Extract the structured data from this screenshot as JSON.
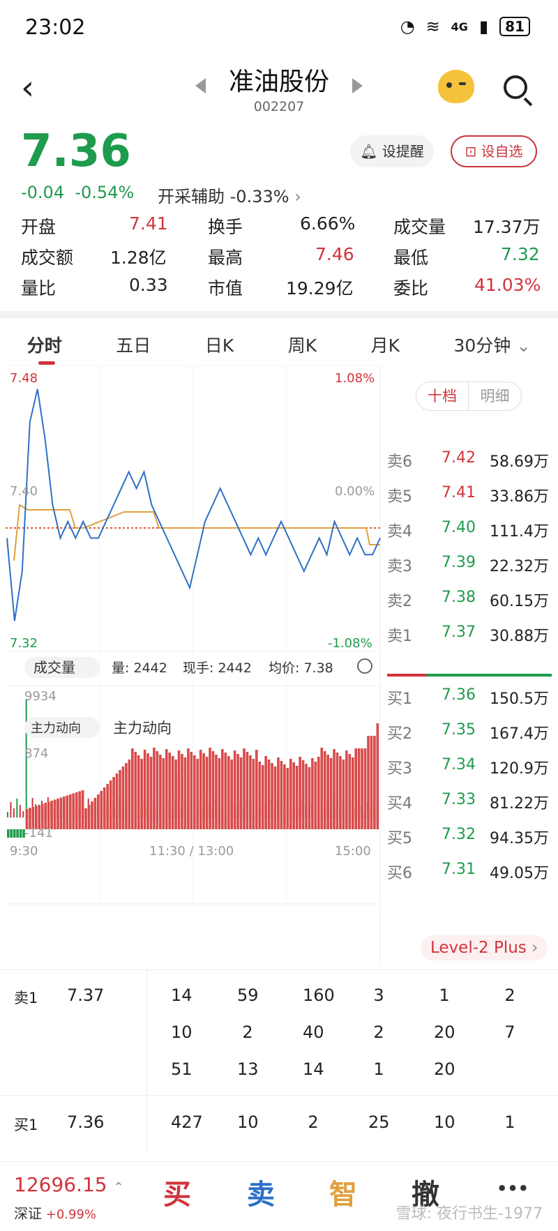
{
  "status_bar": {
    "time": "23:02",
    "network": "4G",
    "battery": "81"
  },
  "header": {
    "title": "准油股份",
    "code": "002207"
  },
  "quote": {
    "price": "7.36",
    "change": "-0.04",
    "change_pct": "-0.54%",
    "aux_label": "开采辅助",
    "aux_value": "-0.33%",
    "alert_label": "设提醒",
    "fav_label": "设自选"
  },
  "stats": [
    {
      "label": "开盘",
      "value": "7.41",
      "color": "red"
    },
    {
      "label": "换手",
      "value": "6.66%",
      "color": "dark"
    },
    {
      "label": "成交量",
      "value": "17.37万",
      "color": "dark"
    },
    {
      "label": "成交额",
      "value": "1.28亿",
      "color": "dark"
    },
    {
      "label": "最高",
      "value": "7.46",
      "color": "red"
    },
    {
      "label": "最低",
      "value": "7.32",
      "color": "green"
    },
    {
      "label": "量比",
      "value": "0.33",
      "color": "dark"
    },
    {
      "label": "市值",
      "value": "19.29亿",
      "color": "dark"
    },
    {
      "label": "委比",
      "value": "41.03%",
      "color": "red"
    }
  ],
  "tabs": [
    "分时",
    "五日",
    "日K",
    "周K",
    "月K",
    "30分钟"
  ],
  "chart": {
    "price_high": "7.48",
    "price_mid": "7.40",
    "price_low": "7.32",
    "pct_high": "1.08%",
    "pct_mid": "0.00%",
    "pct_low": "-1.08%",
    "vol_label": "成交量",
    "vol_amount": "量: 2442",
    "vol_now": "现手: 2442",
    "avg_price": "均价: 7.38",
    "vol_max": "9934",
    "flow_select": "主力动向",
    "flow_title": "主力动向",
    "flow_max": "874",
    "flow_min": "-141",
    "time_start": "9:30",
    "time_mid": "11:30 / 13:00",
    "time_end": "15:00"
  },
  "chart_data": {
    "type": "line",
    "series": [
      {
        "values": [
          7.38,
          7.33,
          7.36,
          7.45,
          7.47,
          7.44,
          7.4,
          7.38,
          7.39,
          7.38,
          7.39,
          7.38,
          7.38,
          7.39,
          7.4,
          7.41,
          7.42,
          7.41,
          7.42,
          7.4,
          7.39,
          7.38,
          7.37,
          7.36,
          7.35,
          7.37,
          7.39,
          7.4,
          7.41,
          7.4,
          7.39,
          7.38,
          7.37,
          7.38,
          7.37,
          7.38,
          7.39,
          7.38,
          7.37,
          7.36,
          7.37,
          7.38,
          7.37,
          7.39,
          7.38,
          7.37,
          7.38,
          7.37,
          7.37,
          7.38
        ]
      }
    ],
    "ylim": [
      7.32,
      7.48
    ]
  },
  "book_toggle": {
    "a": "十档",
    "b": "明细"
  },
  "asks": [
    {
      "label": "卖6",
      "price": "7.42",
      "vol": "58.69万",
      "color": "red"
    },
    {
      "label": "卖5",
      "price": "7.41",
      "vol": "33.86万",
      "color": "red"
    },
    {
      "label": "卖4",
      "price": "7.40",
      "vol": "111.4万",
      "color": "green"
    },
    {
      "label": "卖3",
      "price": "7.39",
      "vol": "22.32万",
      "color": "green"
    },
    {
      "label": "卖2",
      "price": "7.38",
      "vol": "60.15万",
      "color": "green"
    },
    {
      "label": "卖1",
      "price": "7.37",
      "vol": "30.88万",
      "color": "green"
    }
  ],
  "bids": [
    {
      "label": "买1",
      "price": "7.36",
      "vol": "150.5万",
      "color": "green"
    },
    {
      "label": "买2",
      "price": "7.35",
      "vol": "167.4万",
      "color": "green"
    },
    {
      "label": "买3",
      "price": "7.34",
      "vol": "120.9万",
      "color": "green"
    },
    {
      "label": "买4",
      "price": "7.33",
      "vol": "81.22万",
      "color": "green"
    },
    {
      "label": "买5",
      "price": "7.32",
      "vol": "94.35万",
      "color": "green"
    },
    {
      "label": "买6",
      "price": "7.31",
      "vol": "49.05万",
      "color": "green"
    }
  ],
  "level2": "Level-2 Plus",
  "queue": {
    "ask1": {
      "label": "卖1",
      "price": "7.37",
      "rows": [
        [
          "14",
          "59",
          "160",
          "3",
          "1",
          "2"
        ],
        [
          "10",
          "2",
          "40",
          "2",
          "20",
          "7"
        ],
        [
          "51",
          "13",
          "14",
          "1",
          "20",
          ""
        ]
      ]
    },
    "bid1": {
      "label": "买1",
      "price": "7.36",
      "rows": [
        [
          "427",
          "10",
          "2",
          "25",
          "10",
          "1"
        ]
      ]
    }
  },
  "bottom": {
    "index_value": "12696.15",
    "index_name": "深证",
    "index_pct": "+0.99%",
    "buy": "买",
    "sell": "卖",
    "smart": "智",
    "cancel": "撤",
    "more": "•••",
    "watermark": "雪球: 夜行书生-1977"
  }
}
